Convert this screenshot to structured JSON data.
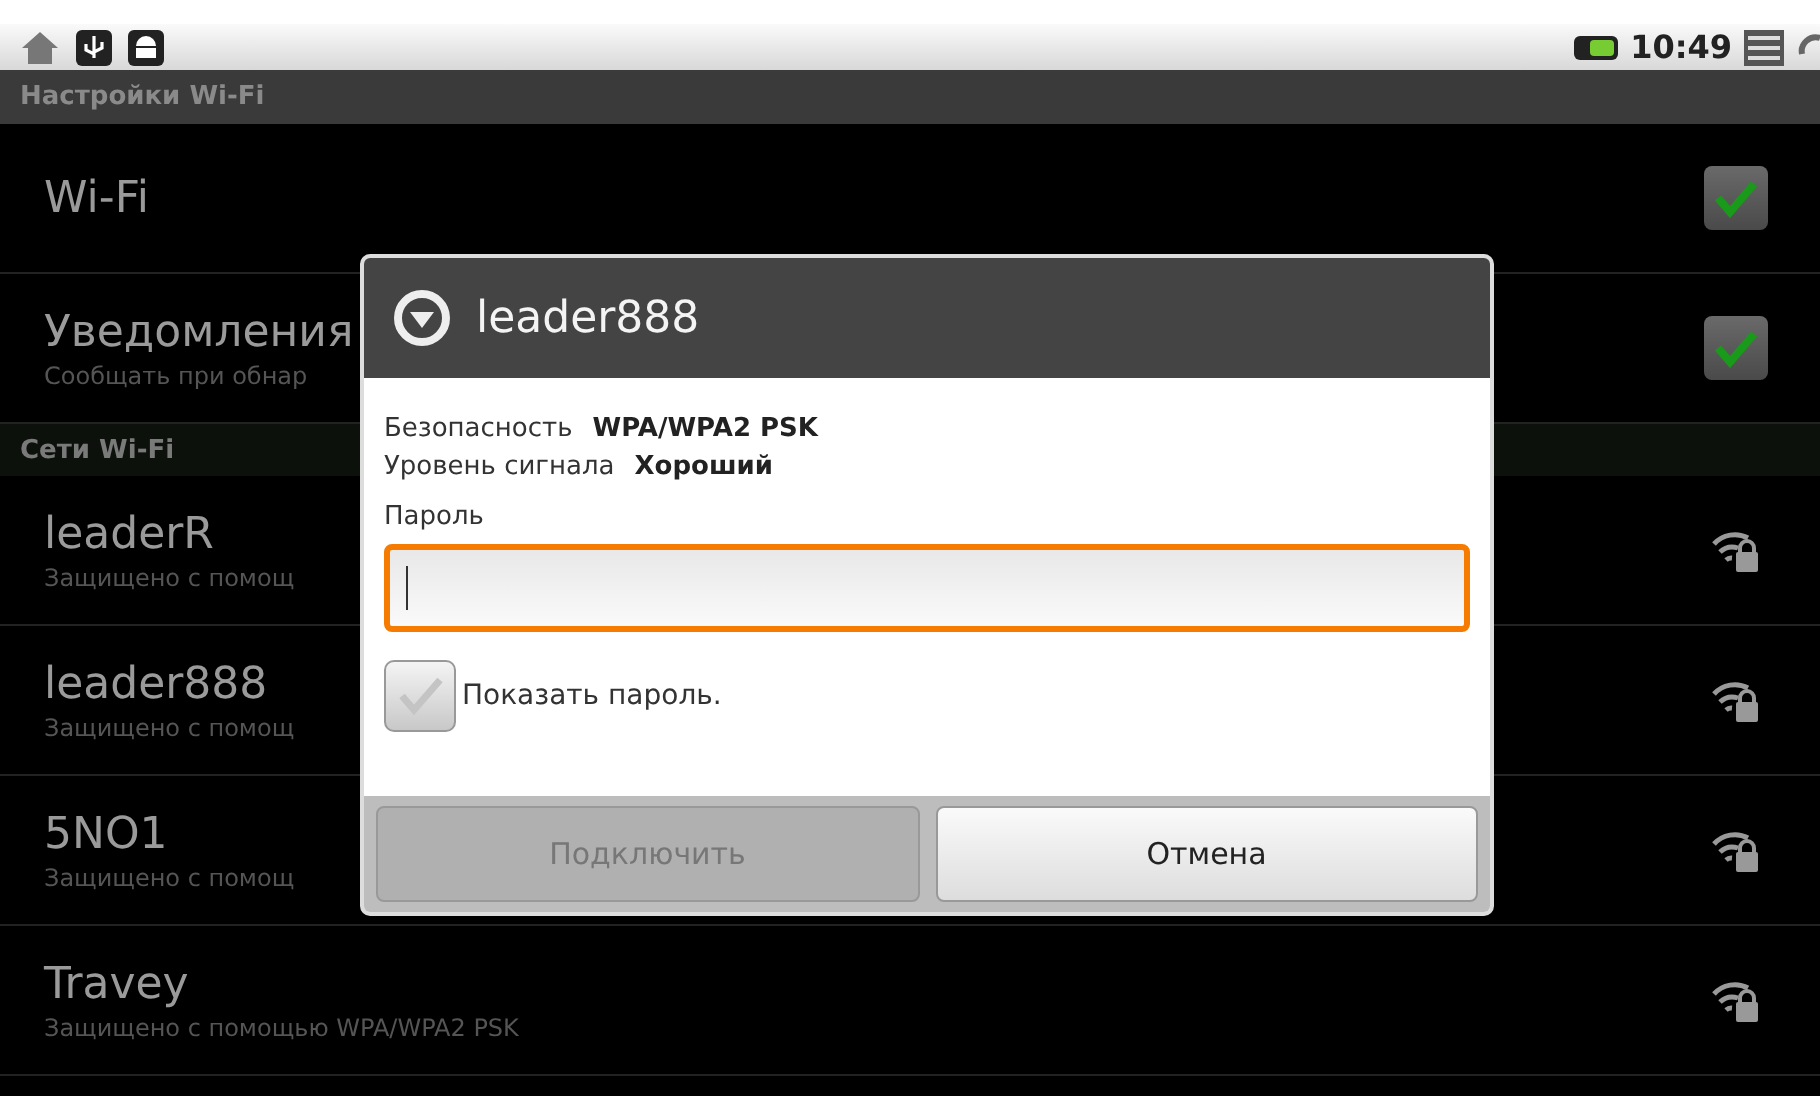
{
  "status_bar": {
    "time": "10:49"
  },
  "title_bar": {
    "title": "Настройки Wi-Fi"
  },
  "settings": [
    {
      "title": "Wi-Fi",
      "checked": true
    },
    {
      "title": "Уведомления",
      "summary": "Сообщать при обнар",
      "checked": true
    }
  ],
  "section": {
    "title": "Сети Wi-Fi"
  },
  "networks": [
    {
      "name": "leaderR",
      "summary": "Защищено с помощ"
    },
    {
      "name": "leader888",
      "summary": "Защищено с помощ"
    },
    {
      "name": "5NO1",
      "summary": "Защищено с помощ"
    },
    {
      "name": "Travey",
      "summary": "Защищено с помощью WPA/WPA2 PSK"
    }
  ],
  "dialog": {
    "title": "leader888",
    "info": [
      {
        "label": "Безопасность",
        "value": "WPA/WPA2 PSK"
      },
      {
        "label": "Уровень сигнала",
        "value": "Хороший"
      }
    ],
    "password_label": "Пароль",
    "show_password": {
      "label": "Показать пароль.",
      "checked": false
    },
    "buttons": [
      {
        "label": "Подключить",
        "disabled": true
      },
      {
        "label": "Отмена",
        "disabled": false
      }
    ]
  }
}
